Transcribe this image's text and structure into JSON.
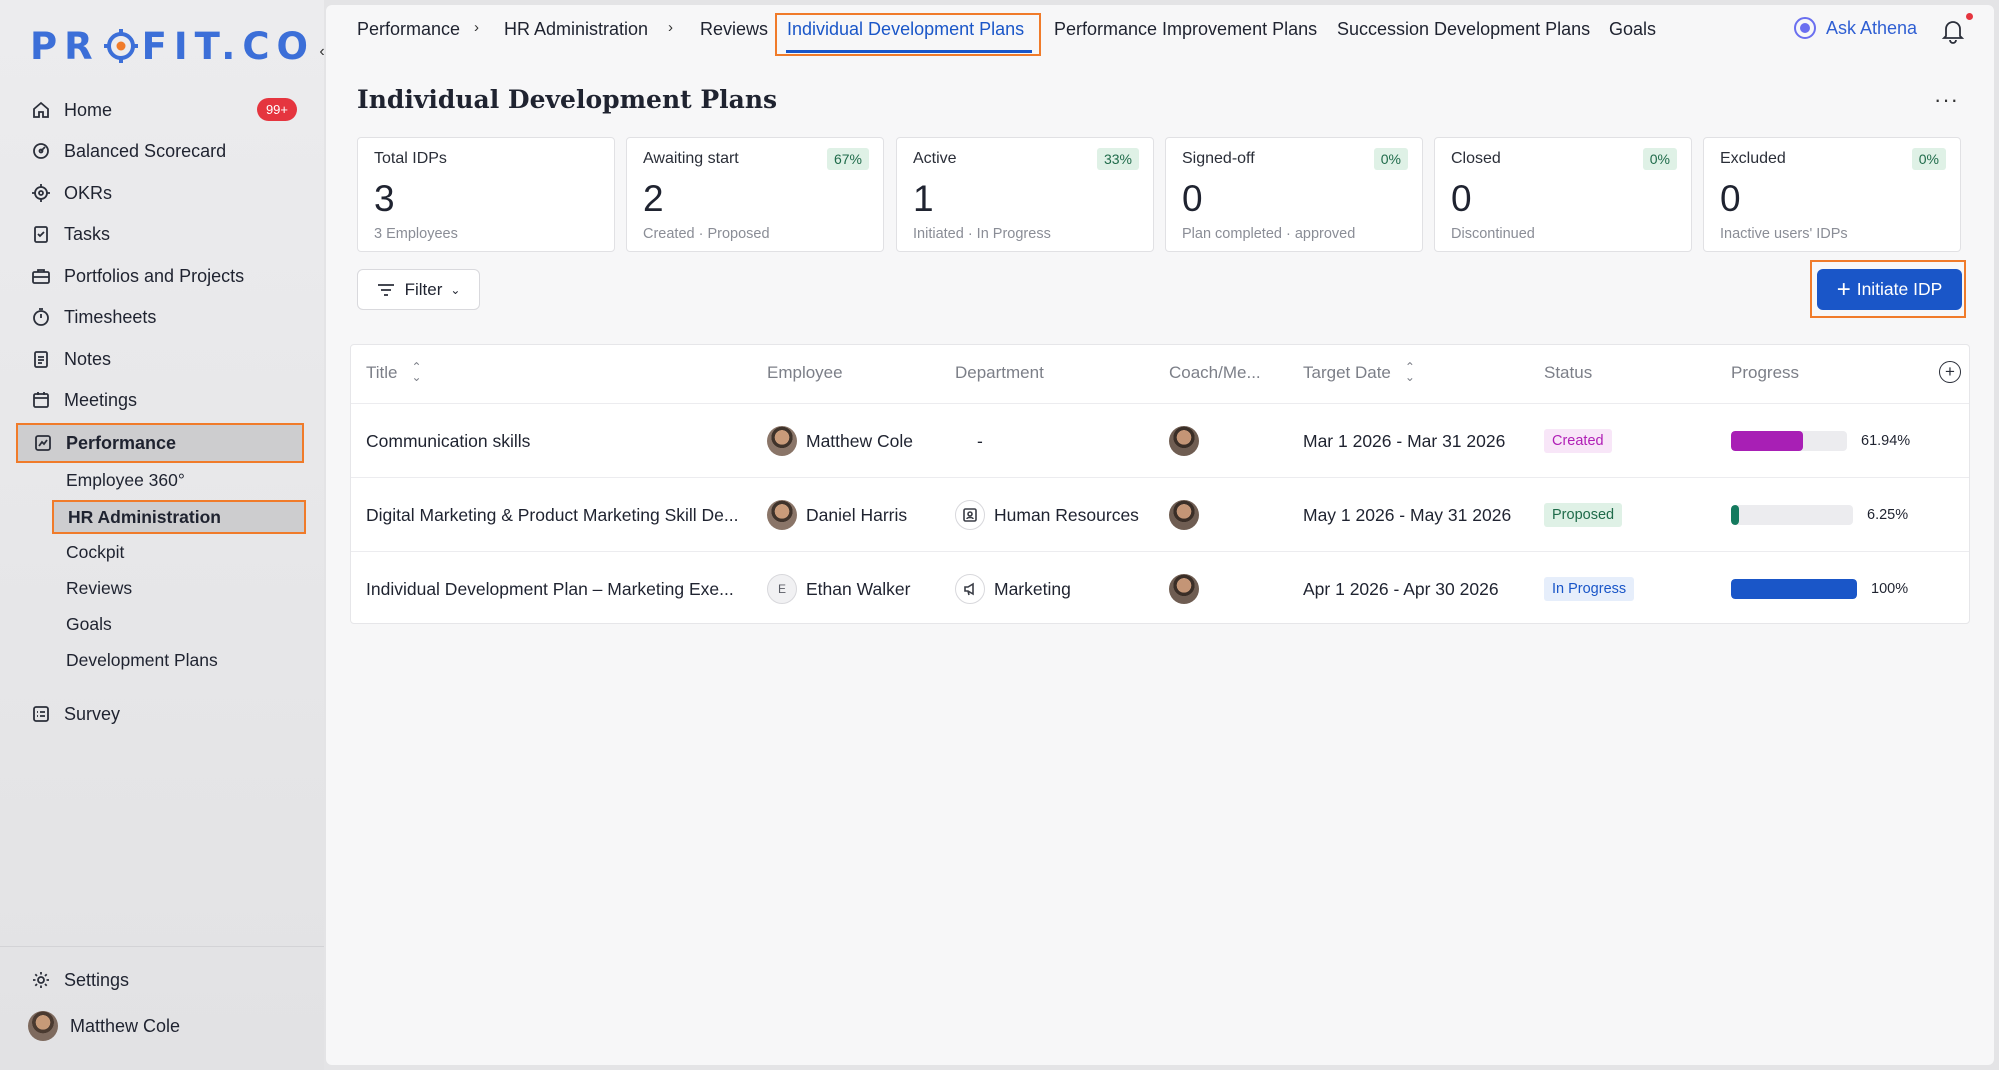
{
  "logo": {
    "text_left": "PR",
    "text_right": "FIT.CO"
  },
  "sidebar": {
    "items": [
      {
        "label": "Home",
        "icon": "home-icon",
        "badge": "99+"
      },
      {
        "label": "Balanced Scorecard",
        "icon": "scorecard-icon"
      },
      {
        "label": "OKRs",
        "icon": "target-icon"
      },
      {
        "label": "Tasks",
        "icon": "clipboard-check-icon"
      },
      {
        "label": "Portfolios and Projects",
        "icon": "briefcase-icon"
      },
      {
        "label": "Timesheets",
        "icon": "stopwatch-icon"
      },
      {
        "label": "Notes",
        "icon": "notes-icon"
      },
      {
        "label": "Meetings",
        "icon": "calendar-icon"
      },
      {
        "label": "Performance",
        "icon": "chart-line-icon"
      }
    ],
    "sub_items": [
      "Employee 360°",
      "HR Administration",
      "Cockpit",
      "Reviews",
      "Goals",
      "Development Plans"
    ],
    "survey": "Survey",
    "settings": "Settings",
    "user_name": "Matthew Cole"
  },
  "topbar": {
    "breadcrumb": [
      "Performance",
      "HR Administration"
    ],
    "tabs": [
      "Reviews",
      "Individual Development Plans",
      "Performance Improvement Plans",
      "Succession Development Plans",
      "Goals"
    ],
    "active_tab": "Individual Development Plans",
    "ask_athena": "Ask Athena"
  },
  "page": {
    "title": "Individual Development Plans",
    "more": "···"
  },
  "stats": [
    {
      "label": "Total IDPs",
      "value": "3",
      "sub": "3 Employees",
      "pct": ""
    },
    {
      "label": "Awaiting start",
      "value": "2",
      "sub": "Created · Proposed",
      "pct": "67%"
    },
    {
      "label": "Active",
      "value": "1",
      "sub": "Initiated · In Progress",
      "pct": "33%"
    },
    {
      "label": "Signed-off",
      "value": "0",
      "sub": "Plan completed · approved",
      "pct": "0%"
    },
    {
      "label": "Closed",
      "value": "0",
      "sub": "Discontinued",
      "pct": "0%"
    },
    {
      "label": "Excluded",
      "value": "0",
      "sub": "Inactive users' IDPs",
      "pct": "0%"
    }
  ],
  "toolbar": {
    "filter": "Filter",
    "initiate": "Initiate IDP"
  },
  "table": {
    "headers": [
      "Title",
      "Employee",
      "Department",
      "Coach/Me...",
      "Target Date",
      "Status",
      "Progress"
    ],
    "rows": [
      {
        "title": "Communication skills",
        "employee": "Matthew Cole",
        "department": "-",
        "target": "Mar 1 2026 - Mar 31 2026",
        "status": "Created",
        "progress": 61.94,
        "progress_label": "61.94%"
      },
      {
        "title": "Digital Marketing & Product Marketing Skill De...",
        "employee": "Daniel Harris",
        "department": "Human Resources",
        "target": "May 1 2026 - May 31 2026",
        "status": "Proposed",
        "progress": 6.25,
        "progress_label": "6.25%"
      },
      {
        "title": "Individual Development Plan – Marketing Exe...",
        "employee": "Ethan Walker",
        "employee_initial": "E",
        "department": "Marketing",
        "target": "Apr 1 2026 - Apr 30 2026",
        "status": "In Progress",
        "progress": 100,
        "progress_label": "100%"
      }
    ]
  },
  "colors": {
    "accent": "#1a56c8",
    "highlight": "#f07b2a",
    "status_created": "#b01fb6",
    "status_proposed": "#1f6b4a",
    "status_in_progress": "#1a56c8",
    "progress_1": "#a81fb5",
    "progress_2": "#147a5e",
    "progress_3": "#1a56c8"
  }
}
